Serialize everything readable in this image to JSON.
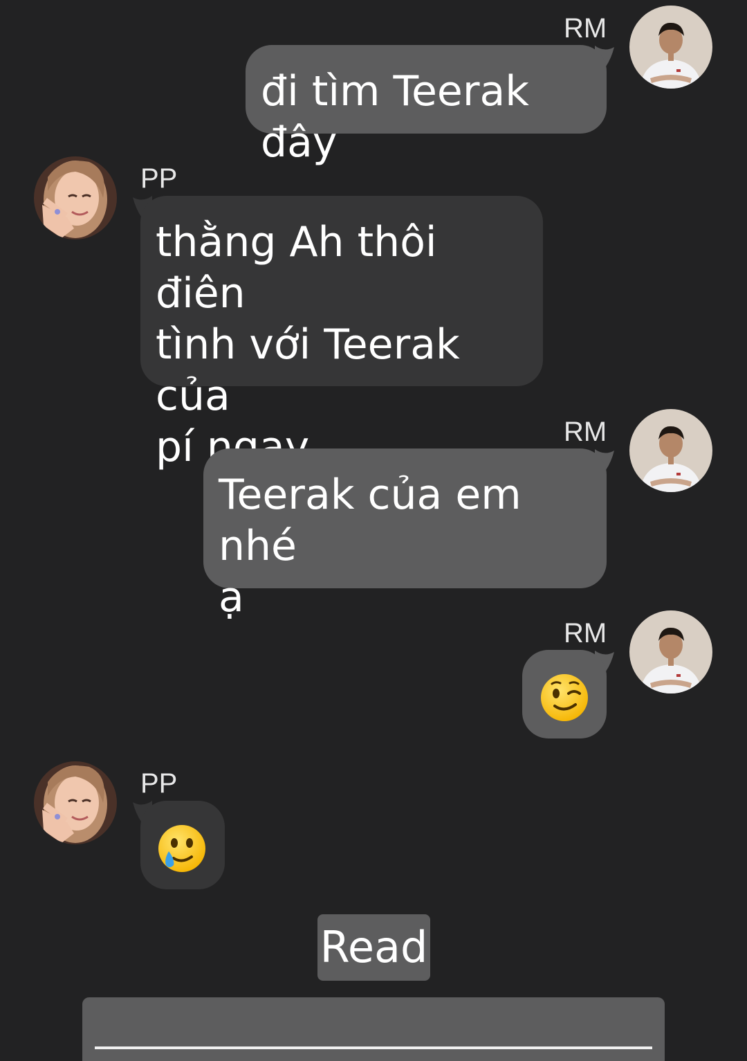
{
  "messages": [
    {
      "sender": "RM",
      "direction": "out",
      "text": "đi tìm Teerak đây"
    },
    {
      "sender": "PP",
      "direction": "in",
      "lines": [
        "thằng Ah thôi điên",
        "tình với Teerak của",
        "pí ngay"
      ]
    },
    {
      "sender": "RM",
      "direction": "out",
      "lines": [
        "Teerak của em nhé",
        "ạ"
      ]
    },
    {
      "sender": "RM",
      "direction": "out",
      "emoji": "winking-face"
    },
    {
      "sender": "PP",
      "direction": "in",
      "emoji": "smiling-face-with-tear"
    }
  ],
  "status": {
    "read_label": "Read"
  },
  "composer": {
    "value": "",
    "placeholder": ""
  },
  "colors": {
    "background": "#222223",
    "outgoing_bubble": "#5d5d5e",
    "incoming_bubble": "#363637",
    "text": "#ffffff"
  }
}
